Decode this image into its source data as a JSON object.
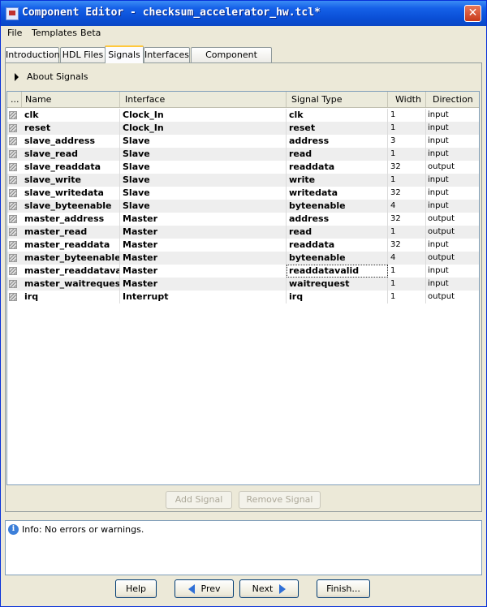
{
  "window": {
    "title": "Component Editor - checksum_accelerator_hw.tcl*"
  },
  "menu": [
    "File",
    "Templates",
    "Beta"
  ],
  "tabs": [
    {
      "label": "Introduction",
      "active": false
    },
    {
      "label": "HDL Files",
      "active": false
    },
    {
      "label": "Signals",
      "active": true
    },
    {
      "label": "Interfaces",
      "active": false
    },
    {
      "label": "Component Wizard",
      "active": false
    }
  ],
  "about": {
    "label": "About Signals"
  },
  "table": {
    "columns": [
      "...",
      "Name",
      "Interface",
      "Signal Type",
      "Width",
      "Direction"
    ],
    "rows": [
      {
        "name": "clk",
        "interface": "Clock_In",
        "signal_type": "clk",
        "width": "1",
        "direction": "input"
      },
      {
        "name": "reset",
        "interface": "Clock_In",
        "signal_type": "reset",
        "width": "1",
        "direction": "input"
      },
      {
        "name": "slave_address",
        "interface": "Slave",
        "signal_type": "address",
        "width": "3",
        "direction": "input"
      },
      {
        "name": "slave_read",
        "interface": "Slave",
        "signal_type": "read",
        "width": "1",
        "direction": "input"
      },
      {
        "name": "slave_readdata",
        "interface": "Slave",
        "signal_type": "readdata",
        "width": "32",
        "direction": "output"
      },
      {
        "name": "slave_write",
        "interface": "Slave",
        "signal_type": "write",
        "width": "1",
        "direction": "input"
      },
      {
        "name": "slave_writedata",
        "interface": "Slave",
        "signal_type": "writedata",
        "width": "32",
        "direction": "input"
      },
      {
        "name": "slave_byteenable",
        "interface": "Slave",
        "signal_type": "byteenable",
        "width": "4",
        "direction": "input"
      },
      {
        "name": "master_address",
        "interface": "Master",
        "signal_type": "address",
        "width": "32",
        "direction": "output"
      },
      {
        "name": "master_read",
        "interface": "Master",
        "signal_type": "read",
        "width": "1",
        "direction": "output"
      },
      {
        "name": "master_readdata",
        "interface": "Master",
        "signal_type": "readdata",
        "width": "32",
        "direction": "input"
      },
      {
        "name": "master_byteenable",
        "interface": "Master",
        "signal_type": "byteenable",
        "width": "4",
        "direction": "output"
      },
      {
        "name": "master_readdatavalid",
        "interface": "Master",
        "signal_type": "readdatavalid",
        "width": "1",
        "direction": "input"
      },
      {
        "name": "master_waitrequest",
        "interface": "Master",
        "signal_type": "waitrequest",
        "width": "1",
        "direction": "input"
      },
      {
        "name": "irq",
        "interface": "Interrupt",
        "signal_type": "irq",
        "width": "1",
        "direction": "output"
      }
    ]
  },
  "signal_buttons": {
    "add": "Add Signal",
    "remove": "Remove Signal"
  },
  "status": {
    "icon": "info-icon",
    "text": "Info: No errors or warnings."
  },
  "nav": {
    "help": "Help",
    "prev": "Prev",
    "next": "Next",
    "finish": "Finish..."
  },
  "colors": {
    "titlebar": "#0a4fd6",
    "active_tab_accent": "#ffc83c",
    "close_button": "#c83a1a"
  }
}
